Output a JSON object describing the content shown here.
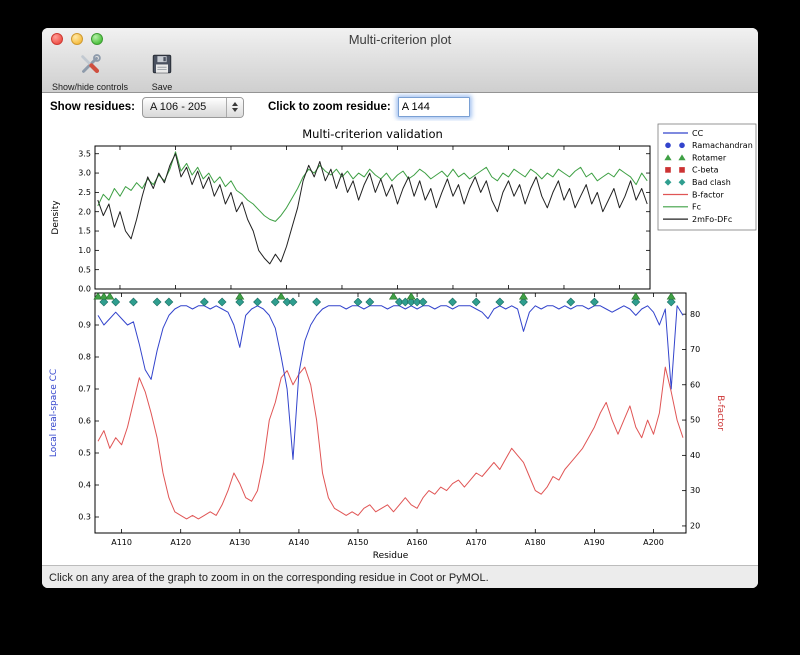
{
  "window": {
    "title": "Multi-criterion plot",
    "toolbar": {
      "show_hide_label": "Show/hide controls",
      "save_label": "Save"
    },
    "controls": {
      "show_residues_label": "Show residues:",
      "residue_range_value": "A 106 - 205",
      "zoom_residue_label": "Click to zoom residue:",
      "zoom_residue_value": "A 144"
    },
    "status_text": "Click on any area of the graph to zoom in on the corresponding residue in Coot or PyMOL."
  },
  "chart_data": {
    "type": "line",
    "title": "Multi-criterion validation",
    "x": {
      "label": "Residue",
      "range": [
        106,
        205
      ],
      "tick_values": [
        110,
        120,
        130,
        140,
        150,
        160,
        170,
        180,
        190,
        200
      ],
      "tick_labels": [
        "A110",
        "A120",
        "A130",
        "A140",
        "A150",
        "A160",
        "A170",
        "A180",
        "A190",
        "A200"
      ]
    },
    "top_plot": {
      "ylabel": "Density",
      "ylim": [
        0.0,
        3.7
      ],
      "yticks": [
        0.0,
        0.5,
        1.0,
        1.5,
        2.0,
        2.5,
        3.0,
        3.5
      ],
      "series": [
        {
          "name": "Fc",
          "color": "#3fa045",
          "values": [
            2.15,
            2.45,
            2.3,
            2.6,
            2.4,
            2.65,
            2.55,
            2.75,
            2.6,
            2.85,
            2.7,
            2.95,
            2.8,
            3.1,
            3.55,
            3.05,
            3.25,
            2.95,
            3.15,
            2.85,
            3.0,
            2.75,
            2.9,
            2.65,
            2.8,
            2.55,
            2.45,
            2.3,
            2.2,
            2.05,
            1.9,
            1.8,
            1.75,
            1.9,
            2.1,
            2.35,
            2.6,
            2.9,
            3.1,
            3.0,
            3.2,
            3.05,
            2.95,
            3.1,
            2.9,
            3.05,
            2.85,
            3.0,
            2.9,
            3.1,
            2.95,
            2.85,
            3.0,
            2.8,
            2.95,
            3.05,
            2.85,
            2.95,
            3.1,
            3.0,
            2.85,
            2.95,
            3.05,
            2.9,
            3.1,
            2.9,
            3.0,
            2.85,
            2.95,
            3.05,
            3.15,
            2.9,
            2.8,
            3.0,
            2.9,
            3.1,
            3.0,
            2.9,
            3.1,
            3.0,
            2.85,
            3.0,
            2.9,
            3.1,
            3.0,
            2.9,
            3.05,
            3.15,
            2.9,
            3.0,
            2.8,
            2.9,
            3.0,
            2.9,
            3.1,
            3.0,
            2.9,
            2.7,
            3.0,
            2.8
          ]
        },
        {
          "name": "2mFo-DFc",
          "color": "#222222",
          "values": [
            2.3,
            1.9,
            2.2,
            1.6,
            2.0,
            1.5,
            1.3,
            1.8,
            2.4,
            2.9,
            2.6,
            3.0,
            2.75,
            3.2,
            3.5,
            2.9,
            3.15,
            2.7,
            3.05,
            2.6,
            2.9,
            2.4,
            2.7,
            2.2,
            2.5,
            2.0,
            2.25,
            1.8,
            1.5,
            1.0,
            0.8,
            0.65,
            0.9,
            0.7,
            1.1,
            1.6,
            2.1,
            2.8,
            3.2,
            2.9,
            3.3,
            2.8,
            3.1,
            2.6,
            3.0,
            2.5,
            2.8,
            2.3,
            2.7,
            3.0,
            2.5,
            2.85,
            2.4,
            2.7,
            2.2,
            2.6,
            2.9,
            2.4,
            2.8,
            2.3,
            2.6,
            2.1,
            2.5,
            2.85,
            2.4,
            2.7,
            2.2,
            2.6,
            2.9,
            2.5,
            2.8,
            2.3,
            2.0,
            2.5,
            2.8,
            2.4,
            2.7,
            2.2,
            2.6,
            2.9,
            2.4,
            2.1,
            2.5,
            2.8,
            2.3,
            2.6,
            2.1,
            2.4,
            2.7,
            2.2,
            2.5,
            2.0,
            2.3,
            2.6,
            2.1,
            2.4,
            2.8,
            2.3,
            2.6,
            2.2
          ]
        }
      ]
    },
    "bottom_plot": {
      "ylabel_left": "Local real-space CC",
      "ylabel_left_color": "#3344cc",
      "ylim_left": [
        0.25,
        1.0
      ],
      "yticks_left": [
        0.3,
        0.4,
        0.5,
        0.6,
        0.7,
        0.8,
        0.9
      ],
      "ylabel_right": "B-factor",
      "ylabel_right_color": "#cc3333",
      "ylim_right": [
        18,
        86
      ],
      "yticks_right": [
        20,
        30,
        40,
        50,
        60,
        70,
        80
      ],
      "series_cc": {
        "name": "CC",
        "color": "#3344cc",
        "values": [
          0.93,
          0.9,
          0.92,
          0.94,
          0.92,
          0.9,
          0.91,
          0.84,
          0.76,
          0.73,
          0.82,
          0.89,
          0.93,
          0.95,
          0.96,
          0.96,
          0.95,
          0.96,
          0.96,
          0.95,
          0.96,
          0.95,
          0.94,
          0.9,
          0.83,
          0.93,
          0.95,
          0.96,
          0.95,
          0.93,
          0.89,
          0.8,
          0.7,
          0.48,
          0.75,
          0.85,
          0.9,
          0.93,
          0.95,
          0.96,
          0.96,
          0.96,
          0.95,
          0.96,
          0.96,
          0.95,
          0.96,
          0.96,
          0.96,
          0.95,
          0.96,
          0.96,
          0.95,
          0.96,
          0.95,
          0.96,
          0.96,
          0.95,
          0.96,
          0.96,
          0.95,
          0.96,
          0.96,
          0.96,
          0.95,
          0.94,
          0.92,
          0.95,
          0.96,
          0.95,
          0.96,
          0.95,
          0.88,
          0.94,
          0.96,
          0.95,
          0.96,
          0.96,
          0.95,
          0.96,
          0.95,
          0.96,
          0.96,
          0.95,
          0.96,
          0.96,
          0.95,
          0.94,
          0.95,
          0.96,
          0.95,
          0.93,
          0.95,
          0.96,
          0.94,
          0.9,
          0.95,
          0.7,
          0.96,
          0.93
        ]
      },
      "series_bfactor": {
        "name": "B-factor",
        "color": "#e05555",
        "values": [
          44,
          47,
          42,
          45,
          43,
          48,
          55,
          62,
          58,
          52,
          45,
          35,
          28,
          24,
          23,
          22,
          23,
          22,
          23,
          24,
          23,
          26,
          30,
          35,
          32,
          28,
          27,
          30,
          38,
          50,
          55,
          62,
          64,
          60,
          63,
          65,
          60,
          50,
          35,
          28,
          25,
          24,
          23,
          24,
          23,
          25,
          26,
          24,
          25,
          26,
          24,
          26,
          28,
          26,
          25,
          28,
          30,
          29,
          31,
          30,
          32,
          33,
          31,
          33,
          35,
          34,
          36,
          38,
          36,
          39,
          42,
          40,
          38,
          34,
          30,
          29,
          31,
          34,
          33,
          36,
          38,
          40,
          42,
          45,
          48,
          52,
          55,
          50,
          46,
          50,
          54,
          48,
          45,
          50,
          46,
          52,
          65,
          58,
          50,
          45
        ]
      },
      "markers": {
        "bad_clash": {
          "color": "#2f9e8f",
          "residues": [
            107,
            109,
            112,
            116,
            118,
            124,
            127,
            130,
            133,
            136,
            138,
            139,
            143,
            150,
            152,
            157,
            158,
            159,
            160,
            161,
            166,
            170,
            174,
            178,
            186,
            190,
            197,
            203
          ]
        },
        "rotamer": {
          "color": "#3fa045",
          "residues": [
            106,
            107,
            108,
            130,
            137,
            156,
            159,
            178,
            197,
            203
          ]
        },
        "ramachandran": {
          "color": "#3344cc",
          "residues": []
        },
        "c_beta": {
          "color": "#cc3333",
          "residues": []
        }
      }
    },
    "legend": {
      "items": [
        {
          "label": "CC",
          "type": "line",
          "color": "#3344cc"
        },
        {
          "label": "Ramachandran",
          "type": "circle",
          "color": "#3344cc"
        },
        {
          "label": "Rotamer",
          "type": "triangle",
          "color": "#3fa045"
        },
        {
          "label": "C-beta",
          "type": "square",
          "color": "#cc3333"
        },
        {
          "label": "Bad clash",
          "type": "diamond",
          "color": "#2f9e8f"
        },
        {
          "label": "B-factor",
          "type": "line",
          "color": "#e05555"
        },
        {
          "label": "Fc",
          "type": "line",
          "color": "#3fa045"
        },
        {
          "label": "2mFo-DFc",
          "type": "line",
          "color": "#222222"
        }
      ]
    }
  }
}
